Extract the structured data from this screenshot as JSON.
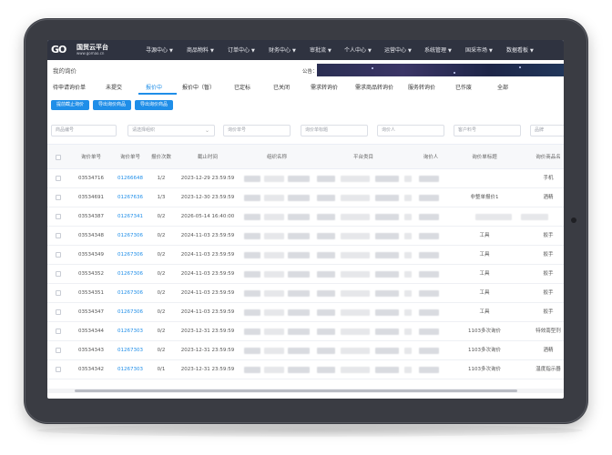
{
  "brand": {
    "mark": "GO",
    "name": "国贸云平台",
    "url": "www.gomao.cn"
  },
  "nav": {
    "items": [
      "寻源中心",
      "商品物料",
      "订单中心",
      "财务中心",
      "审批流",
      "个人中心",
      "运营中心",
      "系统管理",
      "国采市场",
      "数据看板"
    ]
  },
  "page": {
    "breadcrumb": "我的询价",
    "notice_label": "公告："
  },
  "tabs": [
    {
      "label": "待申请询价单"
    },
    {
      "label": "未提交"
    },
    {
      "label": "报价中",
      "active": true
    },
    {
      "label": "报价中（暂）"
    },
    {
      "label": "已定标"
    },
    {
      "label": "已关闭"
    },
    {
      "label": "需求转询价"
    },
    {
      "label": "需求商品转询价"
    },
    {
      "label": "服务转询价"
    },
    {
      "label": "已作废"
    },
    {
      "label": "全部"
    }
  ],
  "actions": [
    "提前截止询价",
    "导出询价商品",
    "导出询价商品"
  ],
  "filters": [
    {
      "placeholder": "商品编号"
    },
    {
      "placeholder": "请选择组织",
      "dropdown": true
    },
    {
      "placeholder": "询价单号"
    },
    {
      "placeholder": "询价单标题"
    },
    {
      "placeholder": "询价人"
    },
    {
      "placeholder": "客户料号"
    },
    {
      "placeholder": "品牌"
    }
  ],
  "table": {
    "headers": [
      "询价单号",
      "询价单号",
      "报价次数",
      "截止时间",
      "组织名称",
      "平台类目",
      "询价人",
      "询价单标题",
      "询价商品名"
    ],
    "rows": [
      {
        "id": "03534716",
        "link": "01266648",
        "count": "1/2",
        "deadline": "2023-12-29 23:59:59",
        "title": "",
        "product": "手机"
      },
      {
        "id": "03534691",
        "link": "01267636",
        "count": "1/3",
        "deadline": "2023-12-30 23:59:59",
        "title": "非整单报价1",
        "product": "酒精"
      },
      {
        "id": "03534387",
        "link": "01267341",
        "count": "0/2",
        "deadline": "2026-05-14 16:40:00",
        "title": "",
        "product": ""
      },
      {
        "id": "03534348",
        "link": "01267306",
        "count": "0/2",
        "deadline": "2024-11-03 23:59:59",
        "title": "工具",
        "product": "扳手"
      },
      {
        "id": "03534349",
        "link": "01267306",
        "count": "0/2",
        "deadline": "2024-11-03 23:59:59",
        "title": "工具",
        "product": "扳手"
      },
      {
        "id": "03534352",
        "link": "01267306",
        "count": "0/2",
        "deadline": "2024-11-03 23:59:59",
        "title": "工具",
        "product": "扳手"
      },
      {
        "id": "03534351",
        "link": "01267306",
        "count": "0/2",
        "deadline": "2024-11-03 23:59:59",
        "title": "工具",
        "product": "扳手"
      },
      {
        "id": "03534347",
        "link": "01267306",
        "count": "0/2",
        "deadline": "2024-11-03 23:59:59",
        "title": "工具",
        "product": "扳手"
      },
      {
        "id": "03534344",
        "link": "01267303",
        "count": "0/2",
        "deadline": "2023-12-31 23:59:59",
        "title": "1103多次询价",
        "product": "特效南型剂"
      },
      {
        "id": "03534343",
        "link": "01267303",
        "count": "0/2",
        "deadline": "2023-12-31 23:59:59",
        "title": "1103多次询价",
        "product": "酒精"
      },
      {
        "id": "03534342",
        "link": "01267303",
        "count": "0/1",
        "deadline": "2023-12-31 23:59:59",
        "title": "1103多次询价",
        "product": "温度指示器"
      }
    ]
  },
  "colors": {
    "nav_bg": "#2f3340",
    "accent": "#1f8ee8",
    "device": "#3a3c43"
  }
}
